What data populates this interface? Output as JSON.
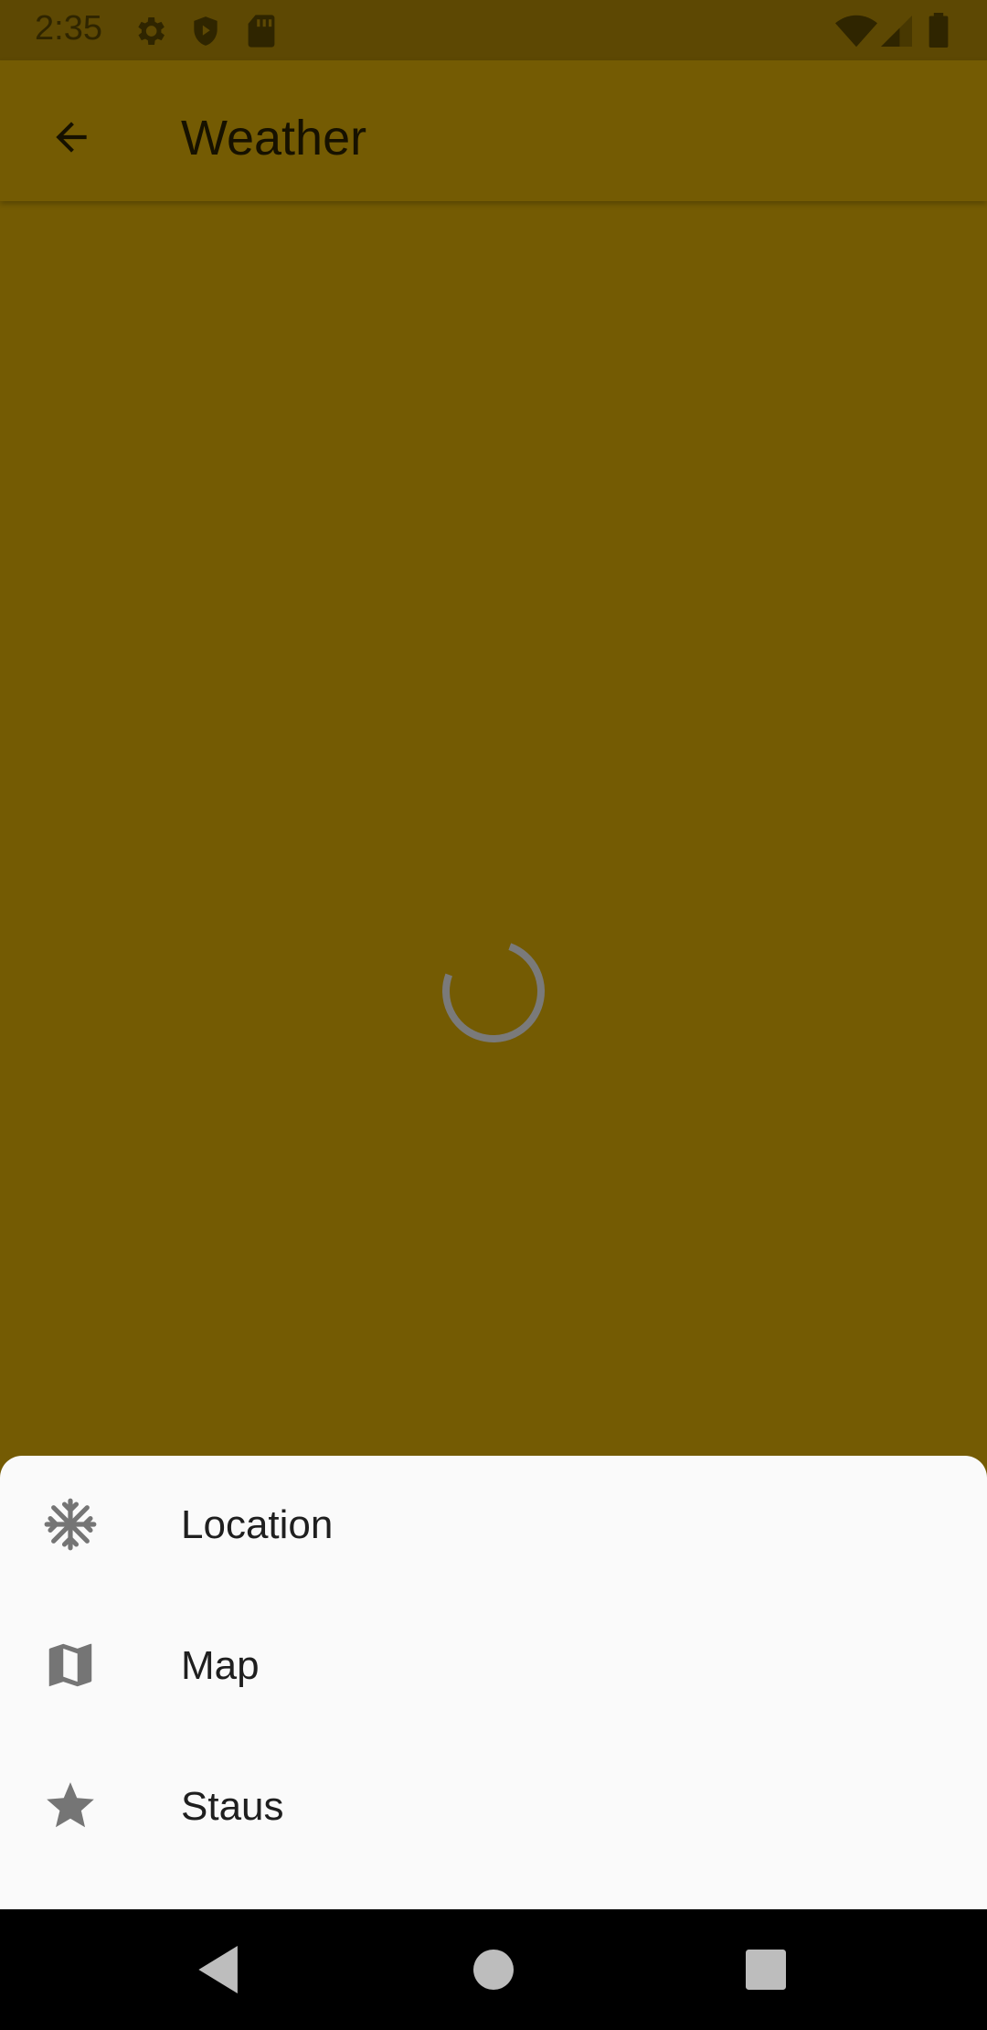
{
  "status_bar": {
    "time": "2:35",
    "icons_left": [
      "gear-icon",
      "shield-play-icon",
      "sd-card-icon"
    ],
    "icons_right": [
      "wifi-icon",
      "signal-icon",
      "battery-icon"
    ]
  },
  "app_bar": {
    "title": "Weather",
    "back_icon": "arrow-back-icon"
  },
  "content": {
    "loading_indicator": "progress-spinner"
  },
  "bottom_sheet": {
    "items": [
      {
        "label": "Location",
        "icon": "snowflake-icon"
      },
      {
        "label": "Map",
        "icon": "map-icon"
      },
      {
        "label": "Staus",
        "icon": "star-icon"
      }
    ]
  },
  "nav_bar": {
    "buttons": [
      "back-triangle-icon",
      "home-circle-icon",
      "recents-square-icon"
    ]
  },
  "colors": {
    "scrim_background": "#745b03",
    "status_bar": "#5d4803",
    "sheet_background": "#fafafa",
    "icon_gray": "#757575"
  }
}
